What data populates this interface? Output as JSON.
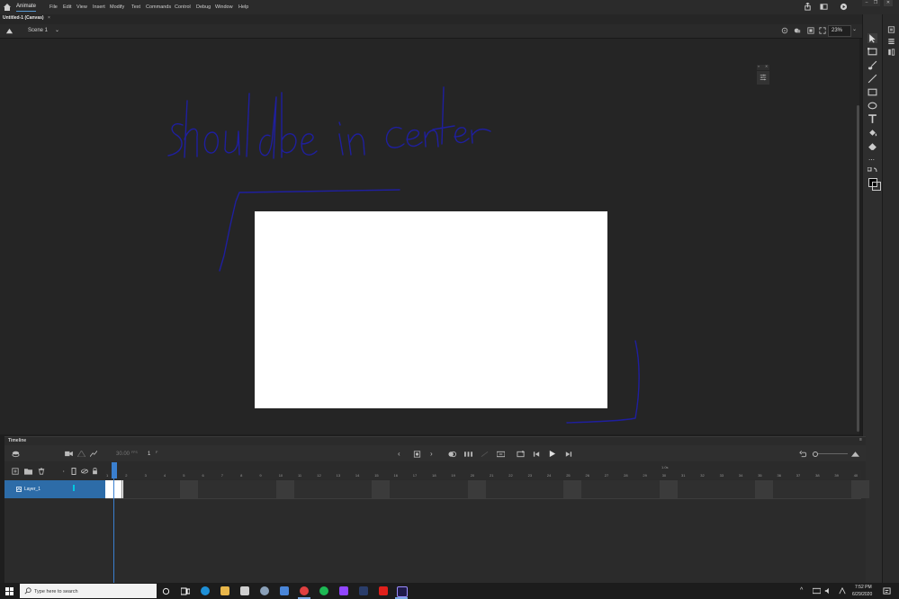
{
  "menubar": {
    "app_name": "Animate",
    "items": [
      "File",
      "Edit",
      "View",
      "Insert",
      "Modify",
      "Text",
      "Commands",
      "Control",
      "Debug",
      "Window",
      "Help"
    ]
  },
  "document": {
    "tab_title": "Untitled-1 (Canvas)",
    "close": "×"
  },
  "scenebar": {
    "scene": "Scene 1",
    "zoom": "23%"
  },
  "annotation": {
    "handwritten_text": "should be in center"
  },
  "timeline": {
    "title": "Timeline",
    "fps": "30.00",
    "fps_unit": "FPS",
    "current_frame": "1",
    "frame_ticks": [
      "1",
      "2",
      "3",
      "4",
      "5",
      "6",
      "7",
      "8",
      "9",
      "10",
      "11",
      "12",
      "13",
      "14",
      "15",
      "16",
      "17",
      "18",
      "19",
      "20",
      "21",
      "22",
      "23",
      "24",
      "25",
      "26",
      "27",
      "28",
      "29",
      "30",
      "31",
      "32",
      "33",
      "34",
      "35",
      "36",
      "37",
      "38",
      "39",
      "40"
    ],
    "second_marker": "1.0s",
    "layer_name": "Layer_1",
    "layer_color": "#00c8e0"
  },
  "taskbar": {
    "search_placeholder": "Type here to search",
    "time": "7:52 PM",
    "date": "6/29/2020"
  },
  "colors": {
    "ink": "#1f1f9e",
    "accent": "#2d6ca8"
  }
}
